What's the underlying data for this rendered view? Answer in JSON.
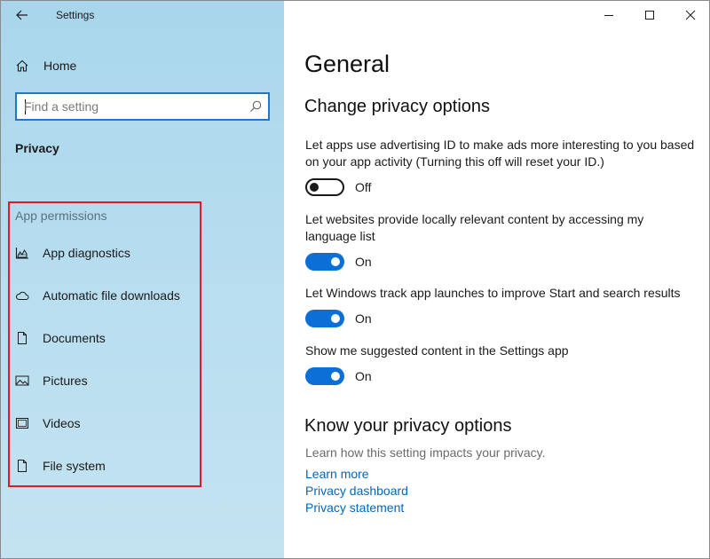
{
  "window": {
    "title": "Settings",
    "controls": [
      "minimize-icon",
      "maximize-icon",
      "close-icon"
    ]
  },
  "sidebar": {
    "home_label": "Home",
    "search": {
      "placeholder": "Find a setting",
      "value": ""
    },
    "section_label": "Privacy",
    "app_permissions": {
      "header": "App permissions",
      "highlight_color": "#e01b24",
      "items": [
        {
          "label": "App diagnostics",
          "icon": "app-diagnostics-icon"
        },
        {
          "label": "Automatic file downloads",
          "icon": "cloud-icon"
        },
        {
          "label": "Documents",
          "icon": "document-icon"
        },
        {
          "label": "Pictures",
          "icon": "picture-icon"
        },
        {
          "label": "Videos",
          "icon": "video-icon"
        },
        {
          "label": "File system",
          "icon": "file-icon"
        }
      ]
    }
  },
  "main": {
    "title": "General",
    "change_section": {
      "heading": "Change privacy options",
      "options": [
        {
          "text": "Let apps use advertising ID to make ads more interesting to you based on your app activity (Turning this off will reset your ID.)",
          "state": "Off",
          "on": false
        },
        {
          "text": "Let websites provide locally relevant content by accessing my language list",
          "state": "On",
          "on": true
        },
        {
          "text": "Let Windows track app launches to improve Start and search results",
          "state": "On",
          "on": true
        },
        {
          "text": "Show me suggested content in the Settings app",
          "state": "On",
          "on": true
        }
      ]
    },
    "know_section": {
      "heading": "Know your privacy options",
      "subtext": "Learn how this setting impacts your privacy.",
      "links": [
        "Learn more",
        "Privacy dashboard",
        "Privacy statement"
      ]
    }
  },
  "colors": {
    "accent": "#0a6fd6",
    "link": "#0067c0",
    "sidebar": "#b6ddef"
  }
}
